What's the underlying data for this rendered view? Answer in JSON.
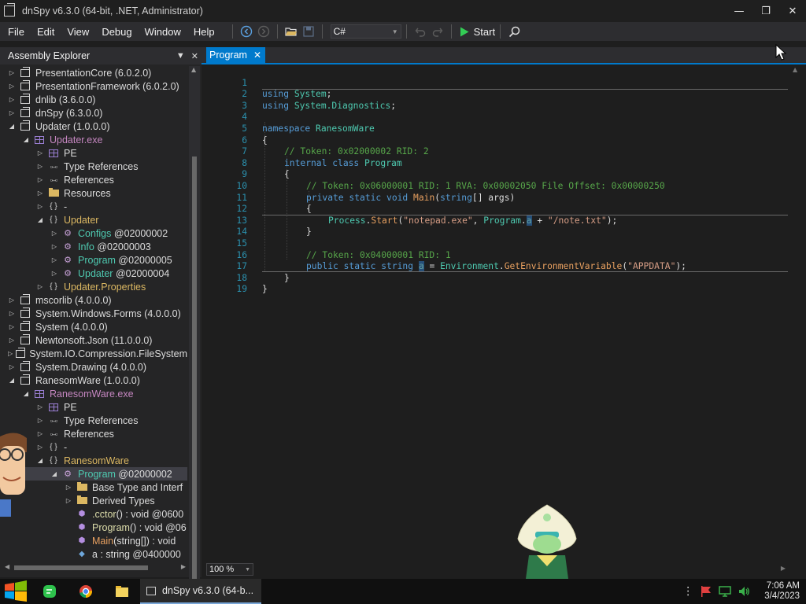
{
  "window": {
    "title": "dnSpy v6.3.0 (64-bit, .NET, Administrator)",
    "minimize": "—",
    "restore": "❐",
    "close": "✕"
  },
  "menu": [
    "File",
    "Edit",
    "View",
    "Debug",
    "Window",
    "Help"
  ],
  "toolbar": {
    "language": "C#",
    "start_label": "Start"
  },
  "explorer": {
    "title": "Assembly Explorer",
    "rows": [
      {
        "label": "PresentationCore (6.0.2.0)"
      },
      {
        "label": "PresentationFramework (6.0.2.0)"
      },
      {
        "label": "dnlib (3.6.0.0)"
      },
      {
        "label": "dnSpy (6.3.0.0)"
      },
      {
        "label": "Updater (1.0.0.0)"
      },
      {
        "label": "Updater.exe"
      },
      {
        "label": "PE"
      },
      {
        "label": "Type References"
      },
      {
        "label": "References"
      },
      {
        "label": "Resources"
      },
      {
        "label": "-"
      },
      {
        "label": "Updater"
      },
      {
        "label": "Configs",
        "sub": "@02000002"
      },
      {
        "label": "Info",
        "sub": "@02000003"
      },
      {
        "label": "Program",
        "sub": "@02000005"
      },
      {
        "label": "Updater",
        "sub": "@02000004"
      },
      {
        "label": "Updater.Properties"
      },
      {
        "label": "mscorlib (4.0.0.0)"
      },
      {
        "label": "System.Windows.Forms (4.0.0.0)"
      },
      {
        "label": "System (4.0.0.0)"
      },
      {
        "label": "Newtonsoft.Json (11.0.0.0)"
      },
      {
        "label": "System.IO.Compression.FileSystem"
      },
      {
        "label": "System.Drawing (4.0.0.0)"
      },
      {
        "label": "RanesomWare (1.0.0.0)"
      },
      {
        "label": "RanesomWare.exe"
      },
      {
        "label": "PE"
      },
      {
        "label": "Type References"
      },
      {
        "label": "References"
      },
      {
        "label": "-"
      },
      {
        "label": "RanesomWare"
      },
      {
        "label": "Program",
        "sub": "@02000002"
      },
      {
        "label": "Base Type and Interf"
      },
      {
        "label": "Derived Types"
      },
      {
        "label": ".cctor",
        "sub": "() : void @0600"
      },
      {
        "label": "Program",
        "sub": "() : void @06"
      },
      {
        "label": "Main",
        "sub": "(string[]) : void"
      },
      {
        "label": "a",
        "sub": ": string @0400000"
      }
    ]
  },
  "document": {
    "tab_title": "Program",
    "zoom": "100 %"
  },
  "code": [
    {
      "n": "1"
    },
    {
      "n": "2"
    },
    {
      "n": "3"
    },
    {
      "n": "4"
    },
    {
      "n": "5"
    },
    {
      "n": "6"
    },
    {
      "n": "7"
    },
    {
      "n": "8"
    },
    {
      "n": "9"
    },
    {
      "n": "10"
    },
    {
      "n": "11"
    },
    {
      "n": "12"
    },
    {
      "n": "13"
    },
    {
      "n": "14"
    },
    {
      "n": "15"
    },
    {
      "n": "16"
    },
    {
      "n": "17"
    },
    {
      "n": "18"
    },
    {
      "n": "19"
    }
  ],
  "code_text": {
    "l1_kw": "using",
    "l1_ns": "System",
    "l1_end": ";",
    "l2_kw": "using",
    "l2_ns": "System.Diagnostics",
    "l2_end": ";",
    "l4_kw": "namespace",
    "l4_ns": "RanesomWare",
    "l5": "{",
    "l6": "// Token: 0x02000002 RID: 2",
    "l7_kw": "internal class",
    "l7_t": "Program",
    "l8": "{",
    "l9": "// Token: 0x06000001 RID: 1 RVA: 0x00002050 File Offset: 0x00000250",
    "l10_kw": "private static void",
    "l10_m": "Main",
    "l10_p1": "(",
    "l10_kw2": "string",
    "l10_p2": "[] args)",
    "l11": "{",
    "l12_t": "Process",
    "l12_dot": ".",
    "l12_m": "Start",
    "l12_p1": "(",
    "l12_s": "\"notepad.exe\"",
    "l12_p2": ", ",
    "l12_t2": "Program",
    "l12_dot2": ".",
    "l12_f": "a",
    "l12_p3": " + ",
    "l12_s2": "\"/note.txt\"",
    "l12_p4": ");",
    "l13": "}",
    "l15": "// Token: 0x04000001 RID: 1",
    "l16_kw": "public static string",
    "l16_f": "a",
    "l16_p1": " = ",
    "l16_t": "Environment",
    "l16_dot": ".",
    "l16_m": "GetEnvironmentVariable",
    "l16_p2": "(",
    "l16_s": "\"APPDATA\"",
    "l16_p3": ");",
    "l17": "}",
    "l18": "}"
  },
  "taskbar": {
    "active_window": "dnSpy v6.3.0 (64-b...",
    "time": "7:06 AM",
    "date": "3/4/2023"
  },
  "colors": {
    "accent": "#007acc",
    "editor_bg": "#1e1e1e",
    "keyword": "#569cd6",
    "type": "#4ec9b0",
    "comment": "#57a64a",
    "string": "#d69d85"
  }
}
